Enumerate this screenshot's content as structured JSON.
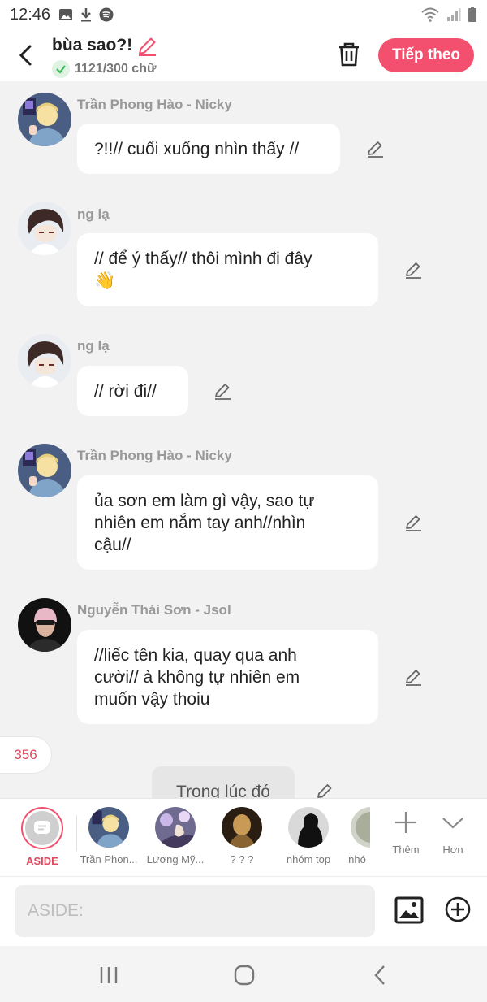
{
  "status_bar": {
    "time": "12:46"
  },
  "header": {
    "title": "bùa sao?!",
    "word_count": "1121/300 chữ",
    "next_label": "Tiếp theo"
  },
  "messages": [
    {
      "sender": "Trần Phong Hào - Nicky",
      "lines": [
        "?!!// cuối xuống nhìn thấy //"
      ]
    },
    {
      "sender": "ng lạ",
      "lines": [
        "// để ý thấy// thôi mình đi đây",
        "👋"
      ]
    },
    {
      "sender": "ng lạ",
      "lines": [
        "// rời đi//"
      ]
    },
    {
      "sender": "Trần Phong Hào - Nicky",
      "lines": [
        "ủa sơn em làm gì vậy, sao tự",
        "nhiên em nắm tay anh//nhìn",
        "cậu//"
      ]
    },
    {
      "sender": "Nguyễn Thái Sơn - Jsol",
      "lines": [
        "//liếc tên kia, quay qua anh",
        "cười// à không tự nhiên em",
        "muốn vậy thoiu"
      ]
    }
  ],
  "comment_count": "356",
  "narration": "Trong lúc đó",
  "characters": [
    {
      "name": "ASIDE"
    },
    {
      "name": "Trần Phon..."
    },
    {
      "name": "Lương Mỹ..."
    },
    {
      "name": "? ? ?"
    },
    {
      "name": "nhóm top"
    },
    {
      "name": "nhó"
    }
  ],
  "tools": {
    "more_label": "Thêm",
    "expand_label": "Hơn"
  },
  "input": {
    "placeholder": "ASIDE:"
  },
  "colors": {
    "accent": "#f2506e",
    "background": "#f2f2f2"
  }
}
